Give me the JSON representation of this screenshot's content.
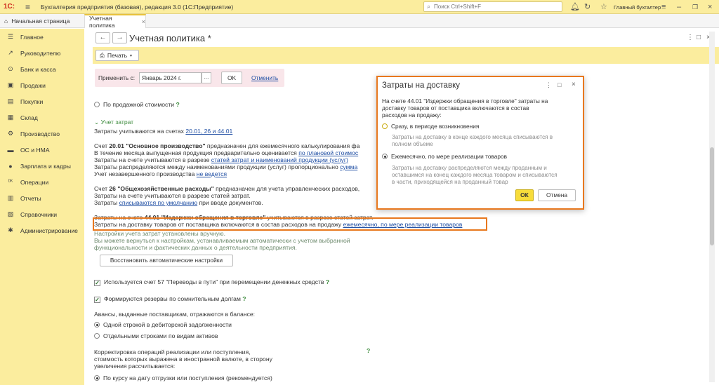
{
  "app": {
    "logo": "1С:",
    "title": "Бухгалтерия предприятия (базовая), редакция 3.0  (1С:Предприятие)",
    "search_placeholder": "Поиск Ctrl+Shift+F",
    "user": "Главный бухгалтер"
  },
  "tabs": {
    "home": "Начальная страница",
    "doc": "Учетная политика",
    "doc_close": "×"
  },
  "sidebar": {
    "items": [
      {
        "label": "Главное",
        "icon": "☰"
      },
      {
        "label": "Руководителю",
        "icon": "↗"
      },
      {
        "label": "Банк и касса",
        "icon": "⊙"
      },
      {
        "label": "Продажи",
        "icon": "▣"
      },
      {
        "label": "Покупки",
        "icon": "▤"
      },
      {
        "label": "Склад",
        "icon": "▦"
      },
      {
        "label": "Производство",
        "icon": "⚙"
      },
      {
        "label": "ОС и НМА",
        "icon": "▬"
      },
      {
        "label": "Зарплата и кадры",
        "icon": "●"
      },
      {
        "label": "Операции",
        "icon": "ᴰᴷ"
      },
      {
        "label": "Отчеты",
        "icon": "▥"
      },
      {
        "label": "Справочники",
        "icon": "▧"
      },
      {
        "label": "Администрирование",
        "icon": "✱"
      }
    ]
  },
  "form": {
    "back": "←",
    "forward": "→",
    "title": "Учетная политика *",
    "print": "Печать",
    "apply_label": "Применить с:",
    "apply_date": "Январь 2024 г.",
    "dots": "...",
    "ok": "OK",
    "cancel": "Отменить"
  },
  "content": {
    "sales_cost": "По продажной стоимости",
    "q": "?",
    "section": "Учет затрат",
    "accounts_intro": "Затраты учитываются на счетах",
    "accounts_link": "20.01, 26 и 44.01",
    "p20_pre": "Счет ",
    "p20_bold": "20.01 \"Основное производство\"",
    "p20_rest": " предназначен для ежемесячного калькулирования фа",
    "p20_l2_pre": "В течение месяца выпущенная продукция предварительно оценивается ",
    "p20_l2_link": "по плановой стоимос",
    "p20_l3_pre": "Затраты на счете учитываются в разрезе ",
    "p20_l3_link": "статей затрат и наименований продукции (услуг)",
    "p20_l4_pre": "Затраты распределяются между наименованиями продукции (услуг) пропорционально ",
    "p20_l4_link": "сумма",
    "p20_l5_pre": "Учет незавершенного производства ",
    "p20_l5_link": "не ведется",
    "p26_pre": "Счет ",
    "p26_bold": "26 \"Общехозяйственные расходы\"",
    "p26_rest": " предназначен для учета управленческих расходов,",
    "p26_l2": "Затраты на счете учитываются в разрезе статей затрат.",
    "p26_l3_pre": "Затраты ",
    "p26_l3_link": "списываются по умолчанию",
    "p26_l3_rest": " при вводе документов.",
    "p44_pre": "Затраты на счете ",
    "p44_bold": "44.01 \"Издержки обращения в торговле\"",
    "p44_rest": " учитываются в разрезе статей затрат.",
    "delivery_text": "Затраты на доставку товаров от поставщика включаются в состав расходов на продажу ",
    "delivery_link": "ежемесячно, по мере реализации товаров",
    "manual_l1": "Настройки учета затрат установлены вручную.",
    "manual_l2": "Вы можете вернуться к настройкам, устанавливаемым автоматически с учетом выбранной",
    "manual_l3": "функциональности и фактических данных о деятельности предприятия.",
    "restore_btn": "Восстановить автоматические настройки",
    "check57": "Используется счет 57 \"Переводы в пути\" при перемещении денежных средств",
    "check_reserves": "Формируются резервы по сомнительным долгам",
    "advances": "Авансы, выданные поставщикам, отражаются в балансе:",
    "adv_one": "Одной строкой в дебиторской задолженности",
    "adv_sep": "Отдельными строками по видам активов",
    "corr_l1": "Корректировка операций реализации или поступления,",
    "corr_l2": "стоимость которых выражена в иностранной валюте, в сторону",
    "corr_l3": "увеличения рассчитывается:",
    "corr_opt": "По курсу на дату отгрузки или поступления (рекомендуется)"
  },
  "dialog": {
    "title": "Затраты на доставку",
    "menu": "⋮",
    "max": "□",
    "close": "×",
    "intro_l1": "На счете 44.01 \"Издержки обращения в торговле\" затраты на",
    "intro_l2": "доставку товаров от поставщика включаются в состав",
    "intro_l3": "расходов на продажу:",
    "opt1": "Сразу, в периоде возникновения",
    "opt1_desc_l1": "Затраты на доставку в конце каждого месяца списываются в",
    "opt1_desc_l2": "полном объеме",
    "opt2": "Ежемесячно, по мере реализации товаров",
    "opt2_desc_l1": "Затраты на доставку распределяются между проданным и",
    "opt2_desc_l2": "оставшимся на конец каждого месяца товаром и списываются",
    "opt2_desc_l3": "в части, приходящейся на проданный товар",
    "ok": "ОК",
    "cancel": "Отмена"
  }
}
